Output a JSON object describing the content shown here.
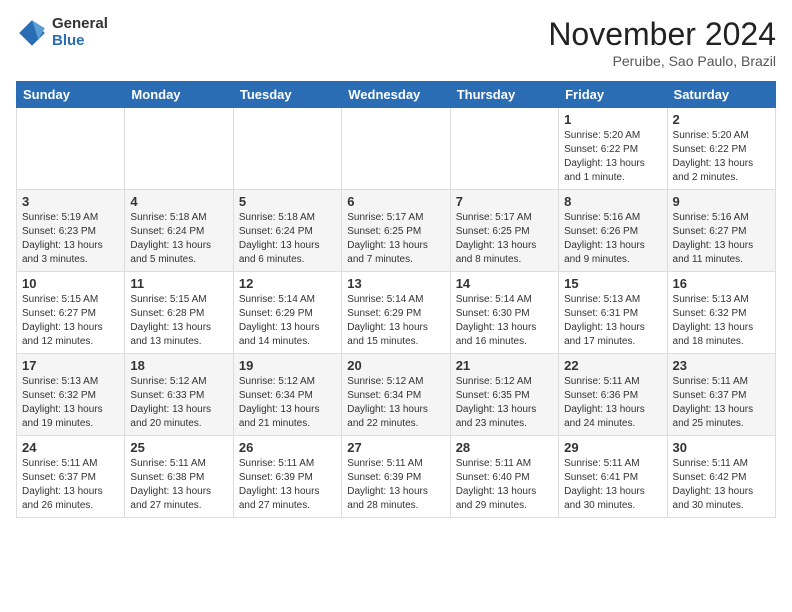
{
  "logo": {
    "general": "General",
    "blue": "Blue"
  },
  "title": "November 2024",
  "location": "Peruibe, Sao Paulo, Brazil",
  "weekdays": [
    "Sunday",
    "Monday",
    "Tuesday",
    "Wednesday",
    "Thursday",
    "Friday",
    "Saturday"
  ],
  "weeks": [
    [
      {
        "day": "",
        "info": ""
      },
      {
        "day": "",
        "info": ""
      },
      {
        "day": "",
        "info": ""
      },
      {
        "day": "",
        "info": ""
      },
      {
        "day": "",
        "info": ""
      },
      {
        "day": "1",
        "info": "Sunrise: 5:20 AM\nSunset: 6:22 PM\nDaylight: 13 hours\nand 1 minute."
      },
      {
        "day": "2",
        "info": "Sunrise: 5:20 AM\nSunset: 6:22 PM\nDaylight: 13 hours\nand 2 minutes."
      }
    ],
    [
      {
        "day": "3",
        "info": "Sunrise: 5:19 AM\nSunset: 6:23 PM\nDaylight: 13 hours\nand 3 minutes."
      },
      {
        "day": "4",
        "info": "Sunrise: 5:18 AM\nSunset: 6:24 PM\nDaylight: 13 hours\nand 5 minutes."
      },
      {
        "day": "5",
        "info": "Sunrise: 5:18 AM\nSunset: 6:24 PM\nDaylight: 13 hours\nand 6 minutes."
      },
      {
        "day": "6",
        "info": "Sunrise: 5:17 AM\nSunset: 6:25 PM\nDaylight: 13 hours\nand 7 minutes."
      },
      {
        "day": "7",
        "info": "Sunrise: 5:17 AM\nSunset: 6:25 PM\nDaylight: 13 hours\nand 8 minutes."
      },
      {
        "day": "8",
        "info": "Sunrise: 5:16 AM\nSunset: 6:26 PM\nDaylight: 13 hours\nand 9 minutes."
      },
      {
        "day": "9",
        "info": "Sunrise: 5:16 AM\nSunset: 6:27 PM\nDaylight: 13 hours\nand 11 minutes."
      }
    ],
    [
      {
        "day": "10",
        "info": "Sunrise: 5:15 AM\nSunset: 6:27 PM\nDaylight: 13 hours\nand 12 minutes."
      },
      {
        "day": "11",
        "info": "Sunrise: 5:15 AM\nSunset: 6:28 PM\nDaylight: 13 hours\nand 13 minutes."
      },
      {
        "day": "12",
        "info": "Sunrise: 5:14 AM\nSunset: 6:29 PM\nDaylight: 13 hours\nand 14 minutes."
      },
      {
        "day": "13",
        "info": "Sunrise: 5:14 AM\nSunset: 6:29 PM\nDaylight: 13 hours\nand 15 minutes."
      },
      {
        "day": "14",
        "info": "Sunrise: 5:14 AM\nSunset: 6:30 PM\nDaylight: 13 hours\nand 16 minutes."
      },
      {
        "day": "15",
        "info": "Sunrise: 5:13 AM\nSunset: 6:31 PM\nDaylight: 13 hours\nand 17 minutes."
      },
      {
        "day": "16",
        "info": "Sunrise: 5:13 AM\nSunset: 6:32 PM\nDaylight: 13 hours\nand 18 minutes."
      }
    ],
    [
      {
        "day": "17",
        "info": "Sunrise: 5:13 AM\nSunset: 6:32 PM\nDaylight: 13 hours\nand 19 minutes."
      },
      {
        "day": "18",
        "info": "Sunrise: 5:12 AM\nSunset: 6:33 PM\nDaylight: 13 hours\nand 20 minutes."
      },
      {
        "day": "19",
        "info": "Sunrise: 5:12 AM\nSunset: 6:34 PM\nDaylight: 13 hours\nand 21 minutes."
      },
      {
        "day": "20",
        "info": "Sunrise: 5:12 AM\nSunset: 6:34 PM\nDaylight: 13 hours\nand 22 minutes."
      },
      {
        "day": "21",
        "info": "Sunrise: 5:12 AM\nSunset: 6:35 PM\nDaylight: 13 hours\nand 23 minutes."
      },
      {
        "day": "22",
        "info": "Sunrise: 5:11 AM\nSunset: 6:36 PM\nDaylight: 13 hours\nand 24 minutes."
      },
      {
        "day": "23",
        "info": "Sunrise: 5:11 AM\nSunset: 6:37 PM\nDaylight: 13 hours\nand 25 minutes."
      }
    ],
    [
      {
        "day": "24",
        "info": "Sunrise: 5:11 AM\nSunset: 6:37 PM\nDaylight: 13 hours\nand 26 minutes."
      },
      {
        "day": "25",
        "info": "Sunrise: 5:11 AM\nSunset: 6:38 PM\nDaylight: 13 hours\nand 27 minutes."
      },
      {
        "day": "26",
        "info": "Sunrise: 5:11 AM\nSunset: 6:39 PM\nDaylight: 13 hours\nand 27 minutes."
      },
      {
        "day": "27",
        "info": "Sunrise: 5:11 AM\nSunset: 6:39 PM\nDaylight: 13 hours\nand 28 minutes."
      },
      {
        "day": "28",
        "info": "Sunrise: 5:11 AM\nSunset: 6:40 PM\nDaylight: 13 hours\nand 29 minutes."
      },
      {
        "day": "29",
        "info": "Sunrise: 5:11 AM\nSunset: 6:41 PM\nDaylight: 13 hours\nand 30 minutes."
      },
      {
        "day": "30",
        "info": "Sunrise: 5:11 AM\nSunset: 6:42 PM\nDaylight: 13 hours\nand 30 minutes."
      }
    ]
  ]
}
